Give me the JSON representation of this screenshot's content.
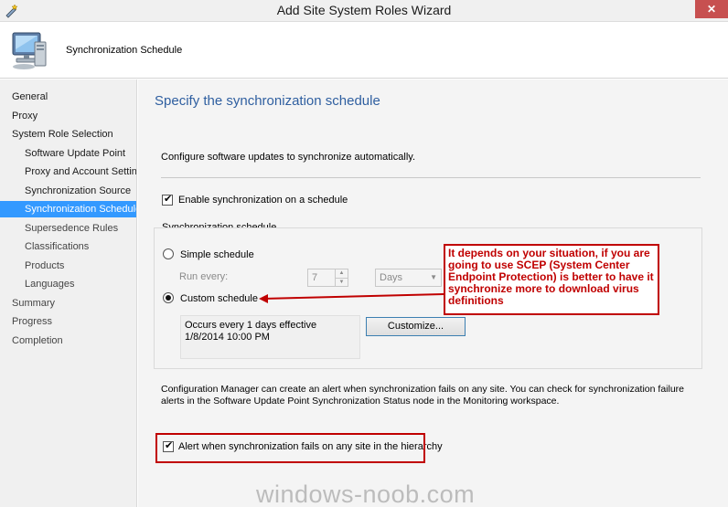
{
  "window": {
    "title": "Add Site System Roles Wizard",
    "close_glyph": "✕"
  },
  "header": {
    "title": "Synchronization Schedule",
    "icon": "computer-icon"
  },
  "nav": {
    "items": [
      {
        "label": "General"
      },
      {
        "label": "Proxy"
      },
      {
        "label": "System Role Selection"
      },
      {
        "label": "Software Update Point"
      },
      {
        "label": "Proxy and Account Settin"
      },
      {
        "label": "Synchronization Source"
      },
      {
        "label": "Synchronization Schedule"
      },
      {
        "label": "Supersedence Rules"
      },
      {
        "label": "Classifications"
      },
      {
        "label": "Products"
      },
      {
        "label": "Languages"
      },
      {
        "label": "Summary"
      },
      {
        "label": "Progress"
      },
      {
        "label": "Completion"
      }
    ],
    "selected_color": "#3399ff"
  },
  "main": {
    "heading": "Specify the synchronization schedule",
    "intro": "Configure software updates to synchronize automatically.",
    "enable_checkbox_label": "Enable synchronization on a schedule",
    "group_label": "Synchronization schedule",
    "simple_schedule_label": "Simple schedule",
    "run_every_label": "Run every:",
    "run_every_value": "7",
    "unit_value": "Days",
    "custom_schedule_label": "Custom schedule",
    "schedule_summary": "Occurs every 1 days effective 1/8/2014 10:00 PM",
    "customize_button": "Customize...",
    "note": "Configuration Manager can create an alert when synchronization fails on any site. You can check for synchronization failure alerts in the Software Update Point Synchronization Status node in the Monitoring workspace.",
    "alert_checkbox_label": "Alert when synchronization fails on any site in the hierarchy"
  },
  "annotation": {
    "callout_text": "It depends on your situation, if you are going to use SCEP (System Center Endpoint Protection) is better to have it synchronize more to download virus definitions",
    "color": "#c00000"
  },
  "watermark": "windows-noob.com",
  "colors": {
    "heading": "#2f5fa0",
    "annotation": "#c00000"
  }
}
